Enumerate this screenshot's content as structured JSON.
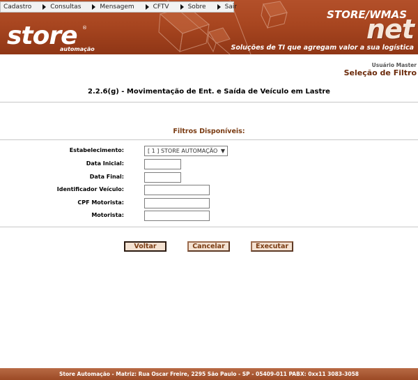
{
  "menu": {
    "items": [
      {
        "label": "Cadastro"
      },
      {
        "label": "Consultas"
      },
      {
        "label": "Mensagem"
      },
      {
        "label": "CFTV"
      },
      {
        "label": "Sobre"
      },
      {
        "label": "Sair"
      }
    ]
  },
  "branding": {
    "logo_text": "store",
    "logo_reg": "®",
    "logo_sub": "automação",
    "product_line1": "STORE/WMAS",
    "product_line2": "net",
    "tagline": "Soluções de TI que agregam valor a sua logística",
    "accent_color": "#a84620"
  },
  "user": {
    "label": "Usuário Master"
  },
  "page": {
    "section": "Seleção de Filtro",
    "title": "2.2.6(g) - Movimentação de Ent. e Saída de Veículo em Lastre"
  },
  "filters": {
    "heading": "Filtros Disponíveis:",
    "fields": [
      {
        "label": "Estabelecimento:",
        "type": "select",
        "value": "[ 1 ] STORE AUTOMAÇÃO"
      },
      {
        "label": "Data Inicial:",
        "type": "text",
        "value": ""
      },
      {
        "label": "Data Final:",
        "type": "text",
        "value": ""
      },
      {
        "label": "Identificador Veículo:",
        "type": "text",
        "value": ""
      },
      {
        "label": "CPF Motorista:",
        "type": "text",
        "value": ""
      },
      {
        "label": "Motorista:",
        "type": "text",
        "value": ""
      }
    ]
  },
  "buttons": {
    "back": "Voltar",
    "cancel": "Cancelar",
    "execute": "Executar"
  },
  "footer": {
    "text": "Store Automação - Matriz: Rua Oscar Freire, 2295 São Paulo - SP - 05409-011 PABX: 0xx11 3083-3058"
  },
  "icons": {
    "menu_arrow": "triangle-right-icon",
    "select_chevron": "chevron-down-icon"
  }
}
